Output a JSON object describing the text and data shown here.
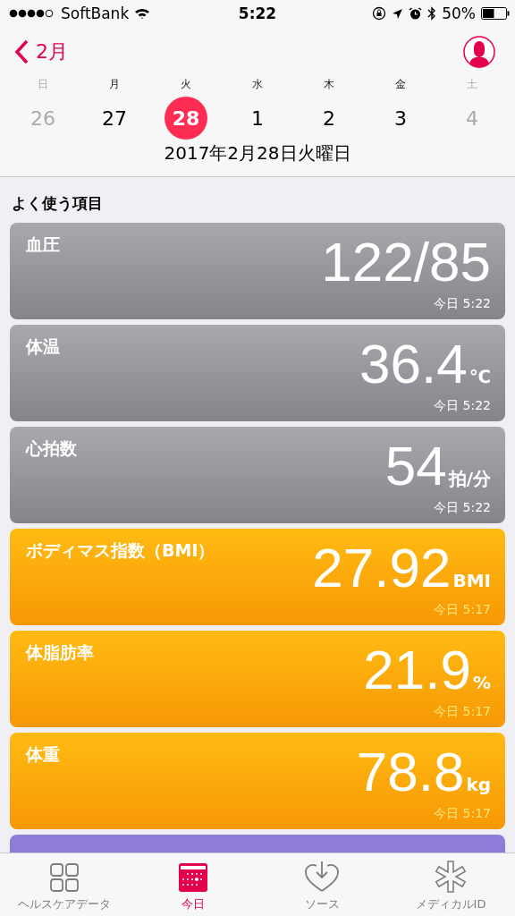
{
  "status_bar": {
    "carrier": "SoftBank",
    "time": "5:22",
    "battery": "50%"
  },
  "nav": {
    "back": "2月"
  },
  "week": [
    {
      "weekday": "日",
      "day": "26",
      "muted": true,
      "selected": false
    },
    {
      "weekday": "月",
      "day": "27",
      "muted": false,
      "selected": false
    },
    {
      "weekday": "火",
      "day": "28",
      "muted": false,
      "selected": true
    },
    {
      "weekday": "水",
      "day": "1",
      "muted": false,
      "selected": false
    },
    {
      "weekday": "木",
      "day": "2",
      "muted": false,
      "selected": false
    },
    {
      "weekday": "金",
      "day": "3",
      "muted": false,
      "selected": false
    },
    {
      "weekday": "土",
      "day": "4",
      "muted": true,
      "selected": false
    }
  ],
  "date_label": "2017年2月28日火曜日",
  "section_title": "よく使う項目",
  "cards": [
    {
      "kind": "vitals",
      "label": "血圧",
      "value": "122/85",
      "time": "今日 5:22"
    },
    {
      "kind": "vitals",
      "label": "体温",
      "value": "36.4",
      "unit": "℃",
      "time": "今日 5:22"
    },
    {
      "kind": "vitals",
      "label": "心拍数",
      "value": "54",
      "unit": "拍/分",
      "time": "今日 5:22"
    },
    {
      "kind": "body",
      "label": "ボディマス指数（BMI）",
      "value": "27.92",
      "unit": "BMI",
      "time": "今日 5:17"
    },
    {
      "kind": "body",
      "label": "体脂肪率",
      "value": "21.9",
      "unit": "%",
      "time": "今日 5:17"
    },
    {
      "kind": "body",
      "label": "体重",
      "value": "78.8",
      "unit": "kg",
      "time": "今日 5:17"
    },
    {
      "kind": "activity"
    }
  ],
  "tab_bar": [
    {
      "kind": "grid",
      "label": "ヘルスケアデータ",
      "selected": false
    },
    {
      "kind": "calendar",
      "label": "今日",
      "selected": true
    },
    {
      "kind": "heart",
      "label": "ソース",
      "selected": false
    },
    {
      "kind": "asterisk",
      "label": "メディカルID",
      "selected": false
    }
  ]
}
